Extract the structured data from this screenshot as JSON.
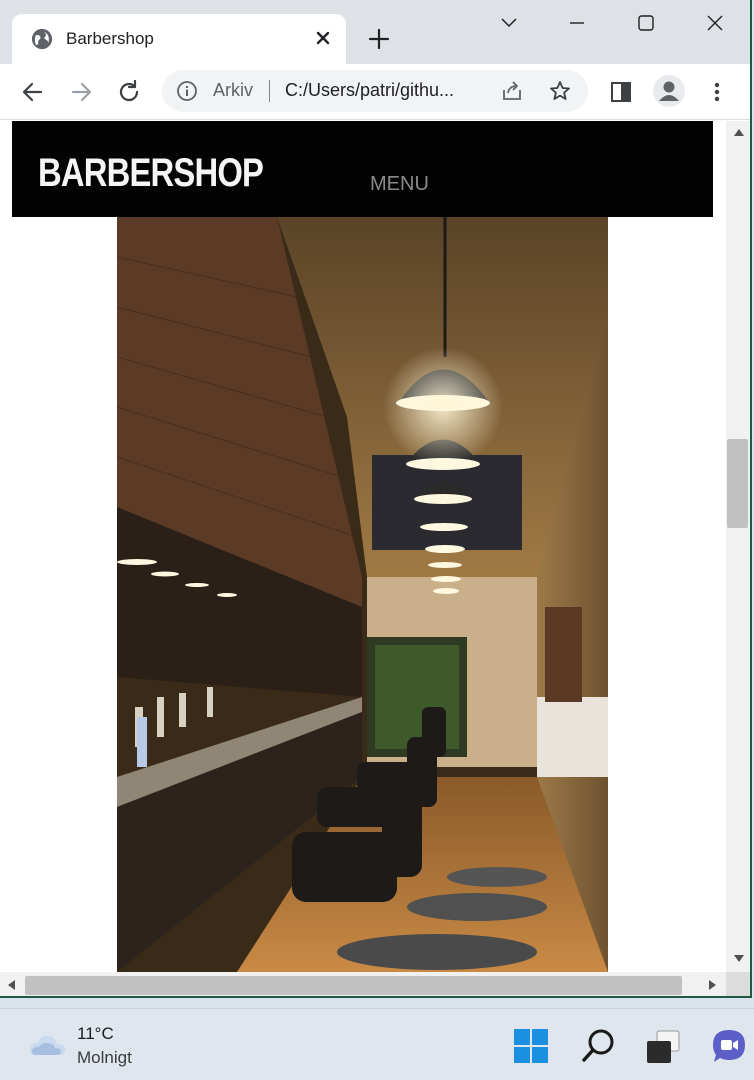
{
  "browser": {
    "tab_title": "Barbershop",
    "address_chip": "Arkiv",
    "url": "C:/Users/patri/githu..."
  },
  "site": {
    "logo": "BARBERSHOP",
    "menu_label": "MENU"
  },
  "taskbar": {
    "temperature": "11°C",
    "weather": "Molnigt"
  },
  "colors": {
    "header_bg": "#030303",
    "tabstrip_bg": "#dee1e6",
    "taskbar_bg": "#dfe6ee"
  }
}
